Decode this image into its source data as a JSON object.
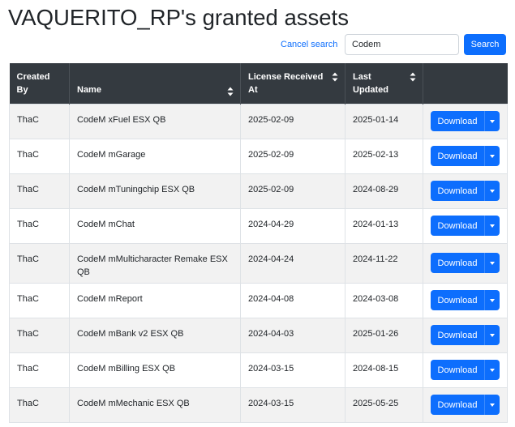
{
  "page": {
    "title": "VAQUERITO_RP's granted assets"
  },
  "search": {
    "cancel_label": "Cancel search",
    "value": "Codem",
    "button_label": "Search"
  },
  "table": {
    "headers": {
      "created_by": "Created By",
      "name": "Name",
      "license_received_at": "License Received At",
      "last_updated": "Last Updated"
    },
    "rows": [
      {
        "created_by": "ThaC",
        "name": "CodeM xFuel ESX QB",
        "license_received_at": "2025-02-09",
        "last_updated": "2025-01-14",
        "action": "Download"
      },
      {
        "created_by": "ThaC",
        "name": "CodeM mGarage",
        "license_received_at": "2025-02-09",
        "last_updated": "2025-02-13",
        "action": "Download"
      },
      {
        "created_by": "ThaC",
        "name": "CodeM mTuningchip ESX QB",
        "license_received_at": "2025-02-09",
        "last_updated": "2024-08-29",
        "action": "Download"
      },
      {
        "created_by": "ThaC",
        "name": "CodeM mChat",
        "license_received_at": "2024-04-29",
        "last_updated": "2024-01-13",
        "action": "Download"
      },
      {
        "created_by": "ThaC",
        "name": "CodeM mMulticharacter Remake ESX QB",
        "license_received_at": "2024-04-24",
        "last_updated": "2024-11-22",
        "action": "Download"
      },
      {
        "created_by": "ThaC",
        "name": "CodeM mReport",
        "license_received_at": "2024-04-08",
        "last_updated": "2024-03-08",
        "action": "Download"
      },
      {
        "created_by": "ThaC",
        "name": "CodeM mBank v2 ESX QB",
        "license_received_at": "2024-04-03",
        "last_updated": "2025-01-26",
        "action": "Download"
      },
      {
        "created_by": "ThaC",
        "name": "CodeM mBilling ESX QB",
        "license_received_at": "2024-03-15",
        "last_updated": "2024-08-15",
        "action": "Download"
      },
      {
        "created_by": "ThaC",
        "name": "CodeM mMechanic ESX QB",
        "license_received_at": "2024-03-15",
        "last_updated": "2025-05-25",
        "action": "Download"
      }
    ]
  },
  "colors": {
    "header_bg": "#343a40",
    "primary": "#0d6efd",
    "stripe": "#f2f2f2"
  },
  "icons": {
    "sort": "sort-arrows-icon",
    "dropdown": "caret-down-icon"
  }
}
